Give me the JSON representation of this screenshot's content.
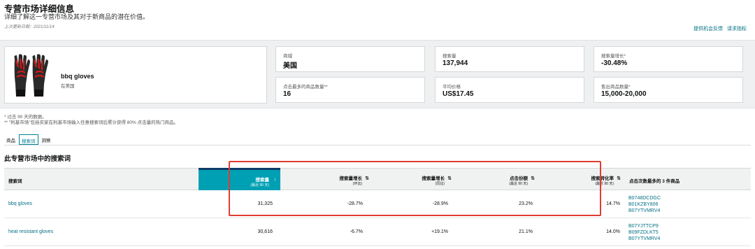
{
  "header": {
    "title": "专营市场详细信息",
    "subtitle": "详细了解这一专营市场及其对于新商品的潜在价值。",
    "last_updated": "上次更新日期：2021/11/14",
    "links": [
      "提供机会反馈",
      "请求指标"
    ]
  },
  "product": {
    "name": "bbq gloves",
    "market": "在美国"
  },
  "metrics": [
    {
      "label": "商城",
      "value": "美国"
    },
    {
      "label": "搜索量",
      "value": "137,944"
    },
    {
      "label": "搜索量增长*",
      "value": "-30.48%"
    },
    {
      "label": "点击最多的商品数量**",
      "value": "16"
    },
    {
      "label": "平均价格",
      "value": "US$17.45"
    },
    {
      "label": "售出商品数量*",
      "value": "15,000-20,000"
    }
  ],
  "footnotes": [
    "* 过去 90 天的数据。",
    "** \"利基市场\"包括买家在利基市场输入任意搜索词后累计获得 80% 点击量的热门商品。"
  ],
  "tabs": [
    {
      "label": "商品",
      "active": false
    },
    {
      "label": "搜索词",
      "active": true
    },
    {
      "label": "洞察",
      "active": false
    }
  ],
  "section_title": "此专营市场中的搜索词",
  "table": {
    "columns": [
      {
        "label": "搜索词",
        "sub": ""
      },
      {
        "label": "搜索量",
        "sub": "(最近 90 天)"
      },
      {
        "label": "搜索量增长",
        "sub": "(环比)"
      },
      {
        "label": "搜索量增长",
        "sub": "(同比)"
      },
      {
        "label": "点击份额",
        "sub": "(最近 90 天)"
      },
      {
        "label": "搜索转化率",
        "sub": "(最近 90 天)"
      },
      {
        "label": "点击次数最多的 3 件商品",
        "sub": ""
      }
    ],
    "sort_arrow": "↓",
    "sortable_arrow": "⇅",
    "rows": [
      {
        "keyword": "bbq gloves",
        "volume": "31,325",
        "growth_mom": "-28.7%",
        "growth_yoy": "-28.9%",
        "click_share": "23.2%",
        "conversion": "14.7%",
        "asins": [
          "B0748DCDGC",
          "B01KZBY806",
          "B07YTVMRV4"
        ]
      },
      {
        "keyword": "heat resistant gloves",
        "volume": "30,616",
        "growth_mom": "-6.7%",
        "growth_yoy": "+19.1%",
        "click_share": "21.1%",
        "conversion": "14.0%",
        "asins": [
          "B07YJTTCP9",
          "B09FZDLKT5",
          "B07YTVMRV4"
        ]
      }
    ]
  },
  "colors": {
    "accent": "#00a0b4",
    "link": "#007185",
    "highlight": "#e03c31"
  }
}
